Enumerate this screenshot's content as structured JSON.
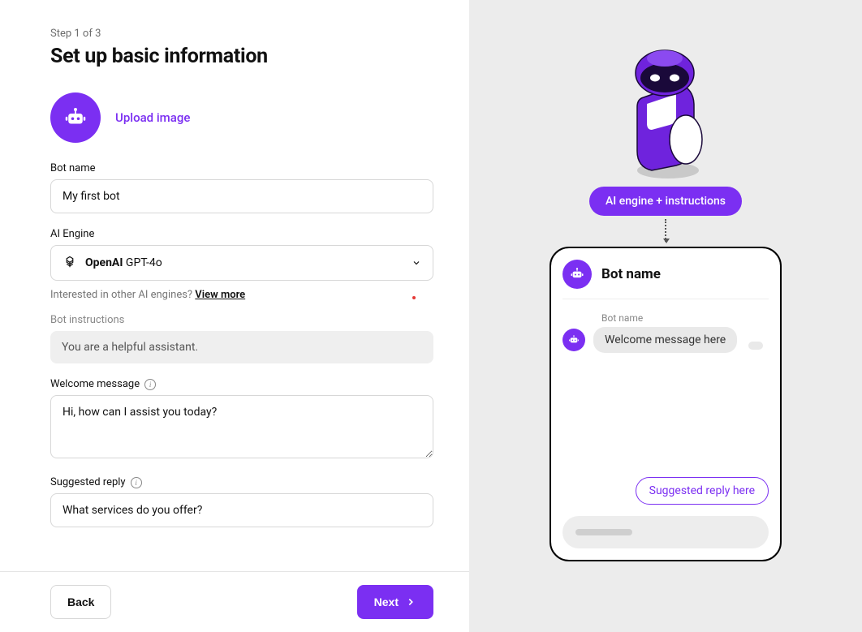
{
  "stepIndicator": "Step 1 of 3",
  "pageTitle": "Set up basic information",
  "uploadLabel": "Upload image",
  "fields": {
    "botName": {
      "label": "Bot name",
      "value": "My first bot"
    },
    "aiEngine": {
      "label": "AI Engine",
      "brand": "OpenAI",
      "model": "GPT-4o"
    },
    "engineHint": {
      "prefix": "Interested in other AI engines?  ",
      "link": "View more"
    },
    "instructions": {
      "label": "Bot instructions",
      "value": "You are a helpful assistant."
    },
    "welcome": {
      "label": "Welcome message",
      "value": "Hi, how can I assist you today?"
    },
    "suggested": {
      "label": "Suggested reply",
      "value": "What services do you offer?"
    }
  },
  "buttons": {
    "back": "Back",
    "next": "Next"
  },
  "preview": {
    "pill": "AI engine + instructions",
    "title": "Bot name",
    "senderLabel": "Bot name",
    "welcomeBubble": "Welcome message here",
    "suggestedPill": "Suggested reply here"
  }
}
